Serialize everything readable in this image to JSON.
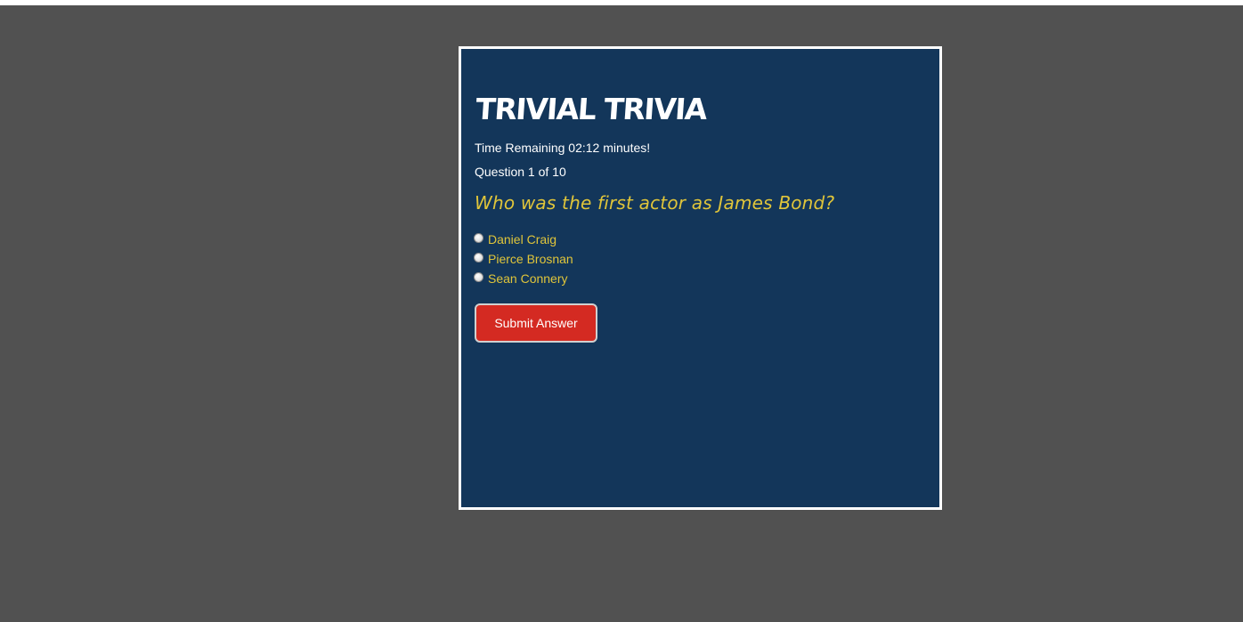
{
  "app": {
    "title": "TRIVIAL TRIVIA"
  },
  "status": {
    "timer_text": "Time Remaining 02:12 minutes!",
    "question_count": "Question 1 of 10"
  },
  "question": {
    "text": "Who was the first actor as James Bond?",
    "options": [
      {
        "label": "Daniel Craig",
        "selected": false
      },
      {
        "label": "Pierce Brosnan",
        "selected": false
      },
      {
        "label": "Sean Connery",
        "selected": false
      }
    ]
  },
  "actions": {
    "submit_label": "Submit Answer"
  },
  "colors": {
    "page_background": "#515151",
    "card_background": "#13365a",
    "card_border": "#ffffff",
    "question_text": "#e0c53a",
    "submit_button": "#d42a22"
  }
}
